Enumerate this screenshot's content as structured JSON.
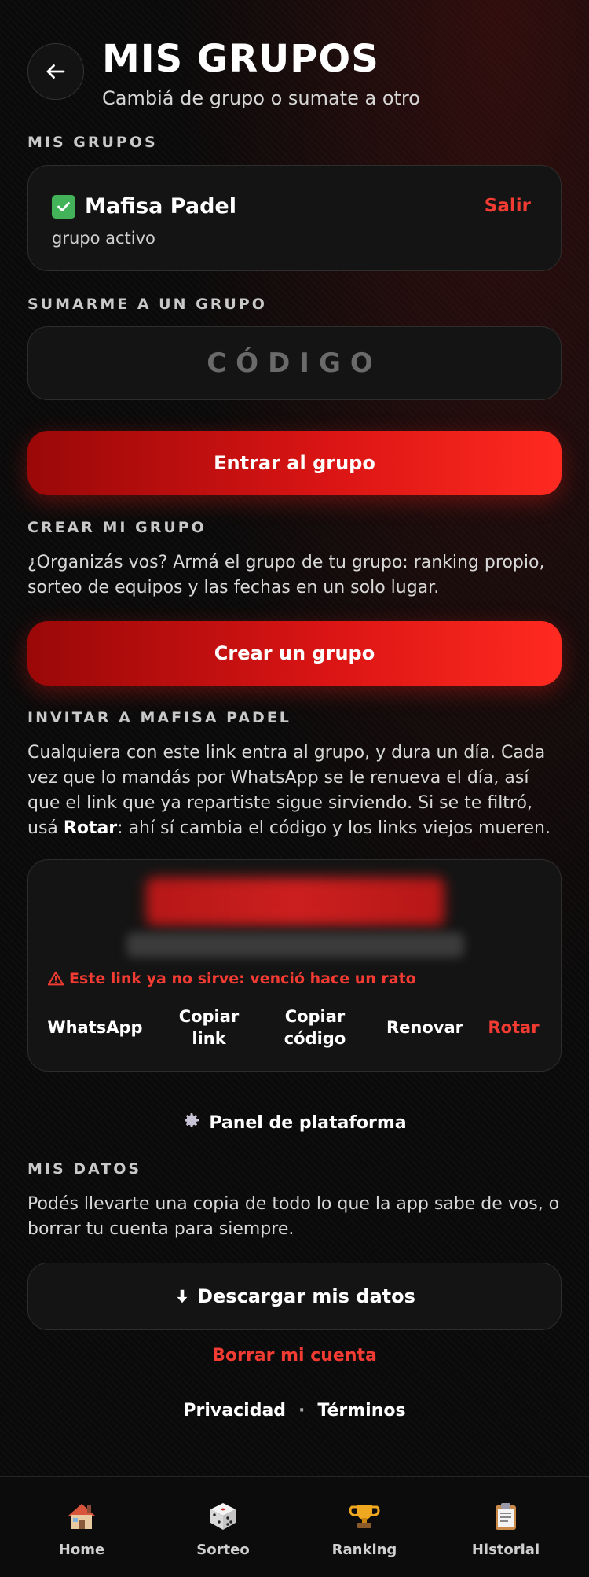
{
  "header": {
    "title": "MIS GRUPOS",
    "subtitle": "Cambiá de grupo o sumate a otro"
  },
  "my_groups": {
    "section_label": "MIS GRUPOS",
    "group_name": "Mafisa Padel",
    "group_status": "grupo activo",
    "leave_label": "Salir"
  },
  "join": {
    "section_label": "SUMARME A UN GRUPO",
    "code_placeholder": "CÓDIGO",
    "button_label": "Entrar al grupo"
  },
  "create": {
    "section_label": "CREAR MI GRUPO",
    "description": "¿Organizás vos? Armá el grupo de tu grupo: ranking propio, sorteo de equipos y las fechas en un solo lugar.",
    "button_label": "Crear un grupo"
  },
  "invite": {
    "section_label": "INVITAR A MAFISA PADEL",
    "description_main": "Cualquiera con este link entra al grupo, y dura un día. Cada vez que lo mandás por WhatsApp se le renueva el día, así que el link que ya repartiste sigue sirviendo. Si se te filtró, usá ",
    "description_bold": "Rotar",
    "description_end": ": ahí sí cambia el código y los links viejos mueren.",
    "warning": "Este link ya no sirve: venció hace un rato",
    "actions": {
      "whatsapp": "WhatsApp",
      "copy_link_1": "Copiar",
      "copy_link_2": "link",
      "copy_code_1": "Copiar",
      "copy_code_2": "código",
      "renew": "Renovar",
      "rotate": "Rotar"
    }
  },
  "platform_label": "Panel de plataforma",
  "my_data": {
    "section_label": "MIS DATOS",
    "description": "Podés llevarte una copia de todo lo que la app sabe de vos, o borrar tu cuenta para siempre.",
    "download_label": "Descargar mis datos",
    "delete_label": "Borrar mi cuenta"
  },
  "legal": {
    "privacy": "Privacidad",
    "separator": "·",
    "terms": "Términos"
  },
  "nav": {
    "home": "Home",
    "sorteo": "Sorteo",
    "ranking": "Ranking",
    "historial": "Historial"
  },
  "colors": {
    "accent_red": "#f23b32",
    "success_green": "#43b35a"
  }
}
